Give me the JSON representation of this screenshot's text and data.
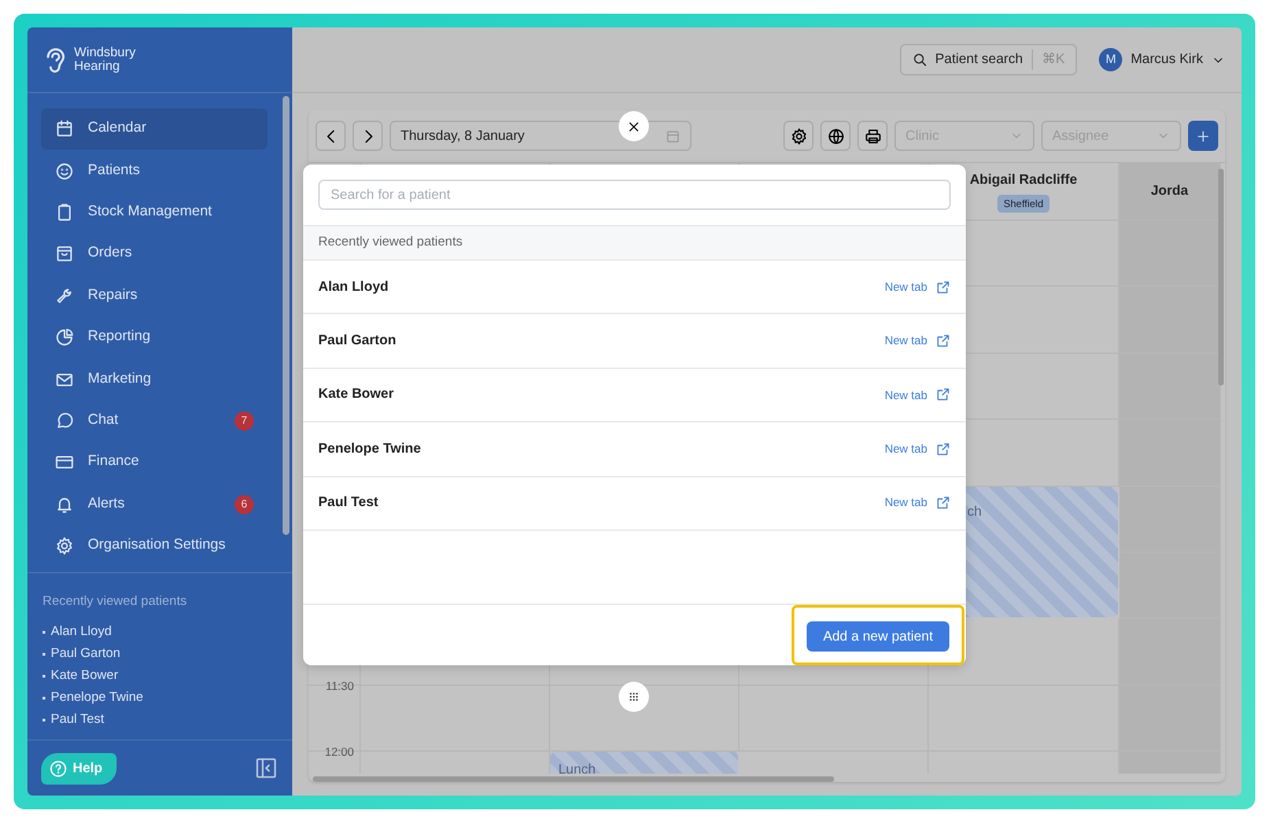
{
  "sidebar": {
    "brand": [
      "Windsbury",
      "Hearing"
    ],
    "nav": [
      {
        "label": "Calendar",
        "selected": true
      },
      {
        "label": "Patients",
        "selected": false
      },
      {
        "label": "Stock Management",
        "selected": false
      },
      {
        "label": "Orders",
        "selected": false
      },
      {
        "label": "Repairs",
        "selected": false
      },
      {
        "label": "Reporting",
        "selected": false
      },
      {
        "label": "Marketing",
        "selected": false
      },
      {
        "label": "Chat",
        "selected": false,
        "badge": "7"
      },
      {
        "label": "Finance",
        "selected": false
      },
      {
        "label": "Alerts",
        "selected": false,
        "badge": "6"
      },
      {
        "label": "Organisation Settings",
        "selected": false
      }
    ],
    "recent_title": "Recently viewed patients",
    "recent": [
      "Alan Lloyd",
      "Paul Garton",
      "Kate Bower",
      "Penelope Twine",
      "Paul Test"
    ],
    "help": "Help"
  },
  "topbar": {
    "search": {
      "label": "Patient search",
      "shortcut": "⌘K"
    },
    "user": {
      "initial": "M",
      "name": "Marcus Kirk"
    }
  },
  "calendar": {
    "date": "Thursday, 8 January",
    "filters": [
      {
        "placeholder": "Clinic"
      },
      {
        "placeholder": "Assignee"
      }
    ],
    "columns": [
      {
        "name": "Abigail Radcliffe",
        "badge": "Sheffield",
        "unavailable": false
      },
      {
        "name": "Jorda",
        "unavailable": true
      }
    ],
    "time_labels": [
      "11:30",
      "12:00"
    ],
    "events": [
      {
        "label": "ch"
      },
      {
        "label": "Lunch"
      }
    ]
  },
  "modal": {
    "search_placeholder": "Search for a patient",
    "section_title": "Recently viewed patients",
    "patients": [
      {
        "name": "Alan Lloyd",
        "link": "New tab"
      },
      {
        "name": "Paul Garton",
        "link": "New tab"
      },
      {
        "name": "Kate Bower",
        "link": "New tab"
      },
      {
        "name": "Penelope Twine",
        "link": "New tab"
      },
      {
        "name": "Paul Test",
        "link": "New tab"
      }
    ],
    "button": {
      "label": "Add a new patient",
      "highlighted": true
    }
  }
}
